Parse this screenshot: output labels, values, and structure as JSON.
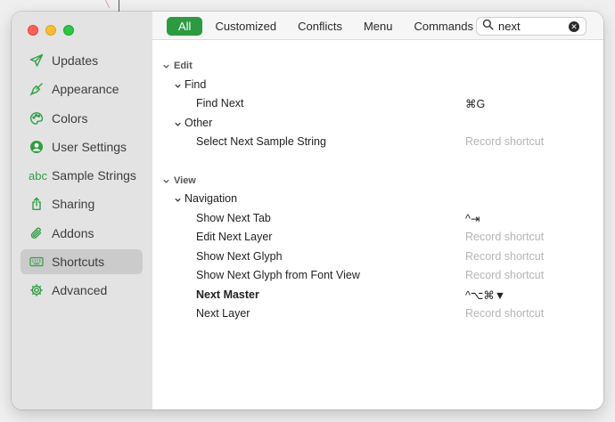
{
  "sidebar": {
    "items": [
      {
        "label": "Updates",
        "icon": "paper-plane-icon"
      },
      {
        "label": "Appearance",
        "icon": "paintbrush-icon"
      },
      {
        "label": "Colors",
        "icon": "palette-icon"
      },
      {
        "label": "User Settings",
        "icon": "user-circle-icon"
      },
      {
        "label": "Sample Strings",
        "icon": "abc-icon",
        "glyph": "abc"
      },
      {
        "label": "Sharing",
        "icon": "share-icon"
      },
      {
        "label": "Addons",
        "icon": "paperclip-icon"
      },
      {
        "label": "Shortcuts",
        "icon": "keyboard-icon"
      },
      {
        "label": "Advanced",
        "icon": "gear-icon"
      }
    ],
    "active": "Shortcuts"
  },
  "toolbar": {
    "tabs": [
      "All",
      "Customized",
      "Conflicts",
      "Menu",
      "Commands"
    ],
    "active_tab": "All",
    "search_value": "next"
  },
  "shortcuts": {
    "edit": {
      "title": "Edit",
      "find": {
        "title": "Find",
        "find_next": {
          "label": "Find Next",
          "shortcut": "⌘G"
        }
      },
      "other": {
        "title": "Other",
        "select_next_sample": {
          "label": "Select Next Sample String",
          "shortcut": "Record shortcut"
        }
      }
    },
    "view": {
      "title": "View",
      "navigation": {
        "title": "Navigation",
        "items": [
          {
            "label": "Show Next Tab",
            "shortcut": "^⇥"
          },
          {
            "label": "Edit Next Layer",
            "shortcut": "Record shortcut"
          },
          {
            "label": "Show Next Glyph",
            "shortcut": "Record shortcut"
          },
          {
            "label": "Show Next Glyph from Font View",
            "shortcut": "Record shortcut"
          },
          {
            "label": "Next Master",
            "shortcut": "^⌥⌘▼"
          },
          {
            "label": "Next Layer",
            "shortcut": "Record shortcut"
          }
        ]
      }
    }
  },
  "colors": {
    "accent": "#2c9a3f",
    "icon_green": "#2ea043",
    "placeholder": "#b5b5b5"
  }
}
